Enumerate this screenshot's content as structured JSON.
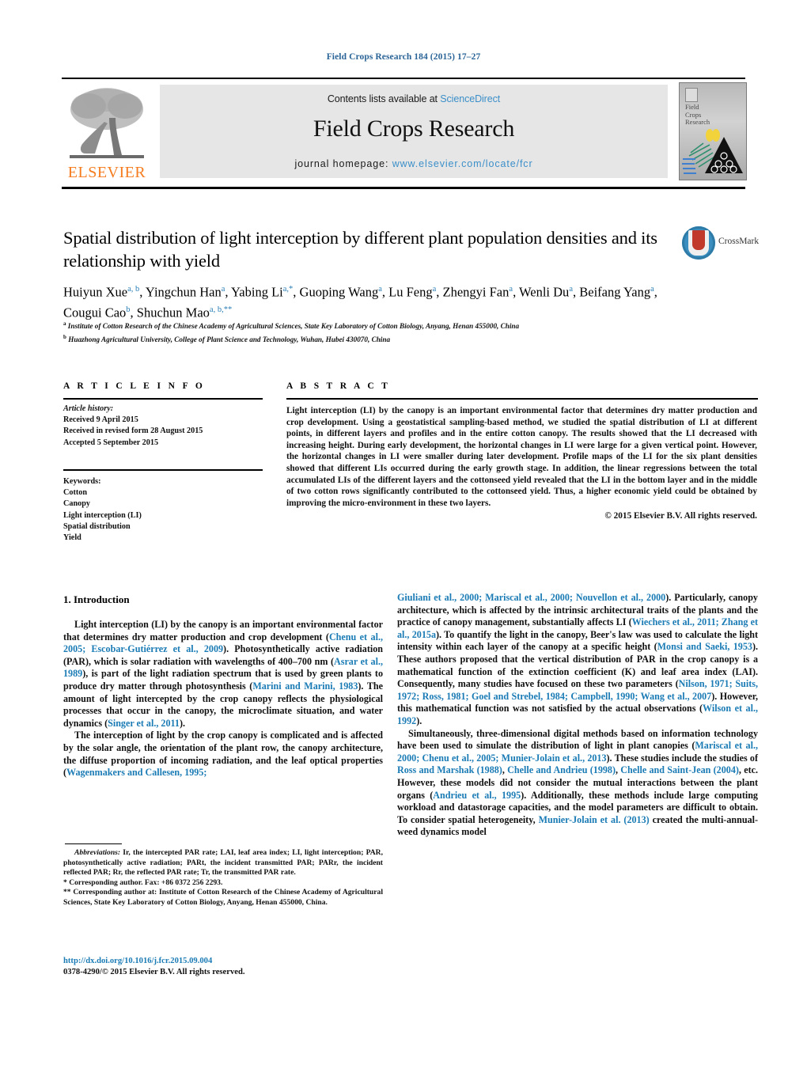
{
  "running_head": "Field Crops Research 184 (2015) 17–27",
  "masthead": {
    "contents_prefix": "Contents lists available at ",
    "contents_link": "ScienceDirect",
    "journal_name": "Field Crops Research",
    "homepage_prefix": "journal homepage: ",
    "homepage_url": "www.elsevier.com/locate/fcr",
    "publisher_logo_text": "ELSEVIER",
    "cover_title_line1": "Field",
    "cover_title_line2": "Crops",
    "cover_title_line3": "Research"
  },
  "article": {
    "title": "Spatial distribution of light interception by different plant population densities and its relationship with yield",
    "crossmark_label": "CrossMark",
    "authors_html": "Huiyun Xue<sup>a, b</sup>, Yingchun Han<sup>a</sup>, Yabing Li<sup>a,*</sup>, Guoping Wang<sup>a</sup>, Lu Feng<sup>a</sup>, Zhengyi Fan<sup>a</sup>, Wenli Du<sup>a</sup>, Beifang Yang<sup>a</sup>, Cougui Cao<sup>b</sup>, Shuchun Mao<sup>a, b,**</sup>",
    "affiliation_a": "Institute of Cotton Research of the Chinese Academy of Agricultural Sciences, State Key Laboratory of Cotton Biology, Anyang, Henan 455000, China",
    "affiliation_b": "Huazhong Agricultural University, College of Plant Science and Technology, Wuhan, Hubei 430070, China"
  },
  "article_info": {
    "heading": "A R T I C L E    I N F O",
    "history_label": "Article history:",
    "received": "Received 9 April 2015",
    "revised": "Received in revised form 28 August 2015",
    "accepted": "Accepted 5 September 2015",
    "keywords_label": "Keywords:",
    "keywords": [
      "Cotton",
      "Canopy",
      "Light interception (LI)",
      "Spatial distribution",
      "Yield"
    ]
  },
  "abstract": {
    "heading": "A B S T R A C T",
    "text": "Light interception (LI) by the canopy is an important environmental factor that determines dry matter production and crop development. Using a geostatistical sampling-based method, we studied the spatial distribution of LI at different points, in different layers and profiles and in the entire cotton canopy. The results showed that the LI decreased with increasing height. During early development, the horizontal changes in LI were large for a given vertical point. However, the horizontal changes in LI were smaller during later development. Profile maps of the LI for the six plant densities showed that different LIs occurred during the early growth stage. In addition, the linear regressions between the total accumulated LIs of the different layers and the cottonseed yield revealed that the LI in the bottom layer and in the middle of two cotton rows significantly contributed to the cottonseed yield. Thus, a higher economic yield could be obtained by improving the micro-environment in these two layers.",
    "copyright": "© 2015 Elsevier B.V. All rights reserved."
  },
  "body": {
    "section_title": "1.  Introduction",
    "left_paragraph_1": "Light interception (LI) by the canopy is an important environmental factor that determines dry matter production and crop development (<span class=\"ref\">Chenu et al., 2005; Escobar-Gutiérrez et al., 2009</span>). Photosynthetically active radiation (PAR), which is solar radiation with wavelengths of 400–700 nm (<span class=\"ref\">Asrar et al., 1989</span>), is part of the light radiation spectrum that is used by green plants to produce dry matter through photosynthesis (<span class=\"ref\">Marini and Marini, 1983</span>). The amount of light intercepted by the crop canopy reflects the physiological processes that occur in the canopy, the microclimate situation, and water dynamics (<span class=\"ref\">Singer et al., 2011</span>).",
    "left_paragraph_2": "The interception of light by the crop canopy is complicated and is affected by the solar angle, the orientation of the plant row, the canopy architecture, the diffuse proportion of incoming radiation, and the leaf optical properties (<span class=\"ref\">Wagenmakers and Callesen, 1995;</span>",
    "right_paragraph_1": "<span class=\"ref\">Giuliani et al., 2000; Mariscal et al., 2000; Nouvellon et al., 2000</span>). Particularly, canopy architecture, which is affected by the intrinsic architectural traits of the plants and the practice of canopy management, substantially affects LI (<span class=\"ref\">Wiechers et al., 2011; Zhang et al., 2015a</span>). To quantify the light in the canopy, Beer's law was used to calculate the light intensity within each layer of the canopy at a specific height (<span class=\"ref\">Monsi and Saeki, 1953</span>). These authors proposed that the vertical distribution of PAR in the crop canopy is a mathematical function of the extinction coefficient (K) and leaf area index (LAI). Consequently, many studies have focused on these two parameters (<span class=\"ref\">Nilson, 1971; Suits, 1972; Ross, 1981; Goel and Strebel, 1984; Campbell, 1990; Wang et al., 2007</span>). However, this mathematical function was not satisfied by the actual observations (<span class=\"ref\">Wilson et al., 1992</span>).",
    "right_paragraph_2": "Simultaneously, three-dimensional digital methods based on information technology have been used to simulate the distribution of light in plant canopies (<span class=\"ref\">Mariscal et al., 2000; Chenu et al., 2005; Munier-Jolain et al., 2013</span>). These studies include the studies of <span class=\"ref\">Ross and Marshak (1988)</span>, <span class=\"ref\">Chelle and Andrieu (1998)</span>, <span class=\"ref\">Chelle and Saint-Jean (2004)</span>, etc. However, these models did not consider the mutual interactions between the plant organs (<span class=\"ref\">Andrieu et al., 1995</span>). Additionally, these methods include large computing workload and datastorage capacities, and the model parameters are difficult to obtain. To consider spatial heterogeneity, <span class=\"ref\">Munier-Jolain et al. (2013)</span> created the multi-annual-weed dynamics model"
  },
  "footnotes": {
    "abbreviations_label": "Abbreviations:",
    "abbreviations_text": " Ir, the intercepted PAR rate; LAI, leaf area index; LI, light interception; PAR, photosynthetically active radiation; PARt, the incident transmitted PAR; PARr, the incident reflected PAR; Rr, the reflected PAR rate; Tr, the transmitted PAR rate.",
    "corresponding_1": "*  Corresponding author. Fax: +86 0372 256 2293.",
    "corresponding_2": "**  Corresponding author at: Institute of Cotton Research of the Chinese Academy of Agricultural Sciences, State Key Laboratory of Cotton Biology, Anyang, Henan 455000, China."
  },
  "footer": {
    "doi": "http://dx.doi.org/10.1016/j.fcr.2015.09.004",
    "issn_line": "0378-4290/© 2015 Elsevier B.V. All rights reserved."
  },
  "colors": {
    "link": "#1a7bb5",
    "elsevier_orange": "#F57C1F",
    "crossmark_blue": "#3a8fc0",
    "crossmark_red": "#c0392b"
  }
}
